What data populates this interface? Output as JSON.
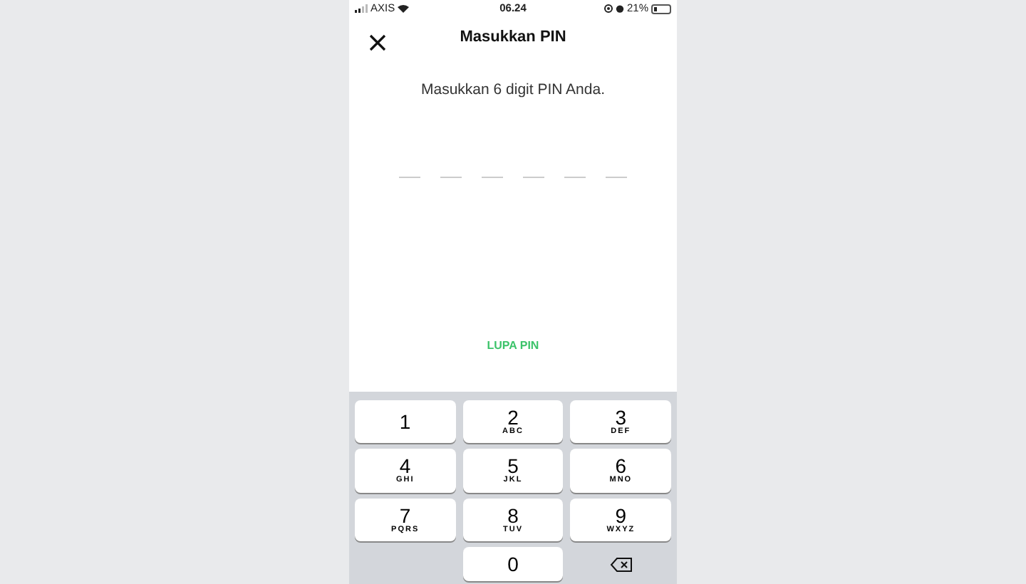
{
  "status_bar": {
    "carrier": "AXIS",
    "time": "06.24",
    "battery": "21%"
  },
  "header": {
    "title": "Masukkan PIN"
  },
  "instruction": "Masukkan 6 digit PIN Anda.",
  "pin_slots": [
    {
      "filled": false
    },
    {
      "filled": false
    },
    {
      "filled": false
    },
    {
      "filled": false
    },
    {
      "filled": false
    },
    {
      "filled": false
    }
  ],
  "forgot_link": "LUPA PIN",
  "keypad": [
    {
      "kind": "digit",
      "digit": "1"
    },
    {
      "kind": "digit",
      "digit": "2",
      "letters": "ABC"
    },
    {
      "kind": "digit",
      "digit": "3",
      "letters": "DEF"
    },
    {
      "kind": "digit",
      "digit": "4",
      "letters": "GHI"
    },
    {
      "kind": "digit",
      "digit": "5",
      "letters": "JKL"
    },
    {
      "kind": "digit",
      "digit": "6",
      "letters": "MNO"
    },
    {
      "kind": "digit",
      "digit": "7",
      "letters": "PQRS"
    },
    {
      "kind": "digit",
      "digit": "8",
      "letters": "TUV"
    },
    {
      "kind": "digit",
      "digit": "9",
      "letters": "WXYZ"
    },
    {
      "kind": "blank"
    },
    {
      "kind": "digit",
      "digit": "0"
    },
    {
      "kind": "delete"
    }
  ]
}
